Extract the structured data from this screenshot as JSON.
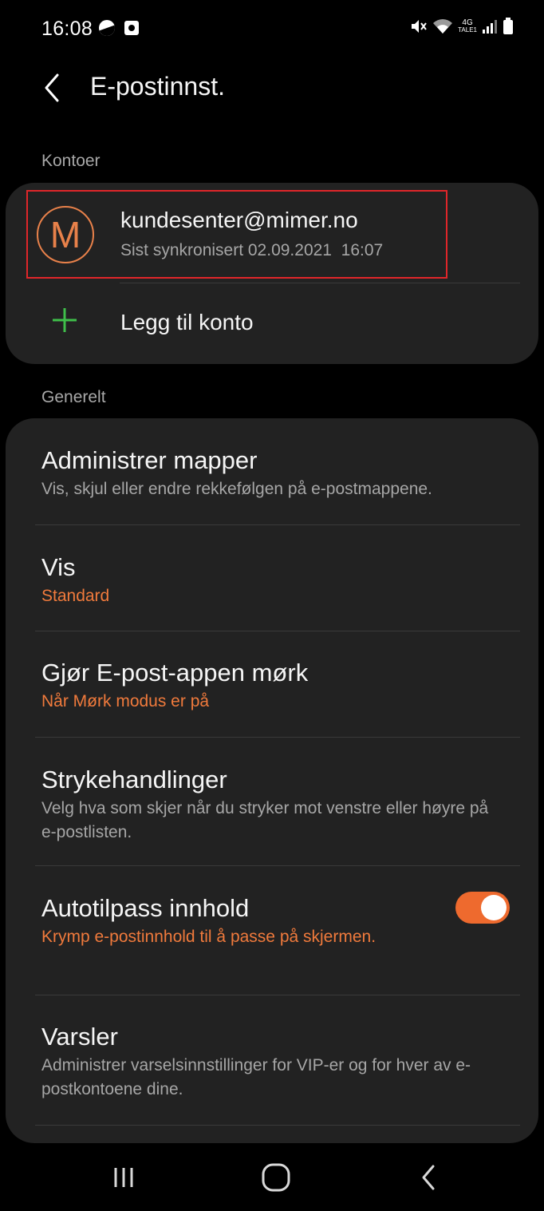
{
  "status_bar": {
    "time": "16:08",
    "network_label": "4G",
    "network_sublabel": "TALE1"
  },
  "header": {
    "title": "E-postinnst."
  },
  "accounts": {
    "section_label": "Kontoer",
    "account": {
      "avatar_letter": "M",
      "email": "kundesenter@mimer.no",
      "sync_status": "Sist synkronisert 02.09.2021  16:07"
    },
    "add_account_label": "Legg til konto"
  },
  "general": {
    "section_label": "Generelt",
    "items": [
      {
        "title": "Administrer mapper",
        "subtitle": "Vis, skjul eller endre rekkefølgen på e-postmappene."
      },
      {
        "title": "Vis",
        "subtitle": "Standard"
      },
      {
        "title": "Gjør E-post-appen mørk",
        "subtitle": "Når Mørk modus er på"
      },
      {
        "title": "Strykehandlinger",
        "subtitle": "Velg hva som skjer når du stryker mot venstre eller høyre på e-postlisten."
      },
      {
        "title": "Autotilpass innhold",
        "subtitle": "Krymp e-postinnhold til å passe på skjermen.",
        "toggle_on": true
      },
      {
        "title": "Varsler",
        "subtitle": "Administrer varselsinnstillinger for VIP-er og for hver av e-postkontoene dine."
      }
    ]
  },
  "colors": {
    "accent": "#ee6a2e",
    "avatar": "#e8814a",
    "highlight_border": "#e0262a",
    "add_icon": "#3fbf4a"
  }
}
